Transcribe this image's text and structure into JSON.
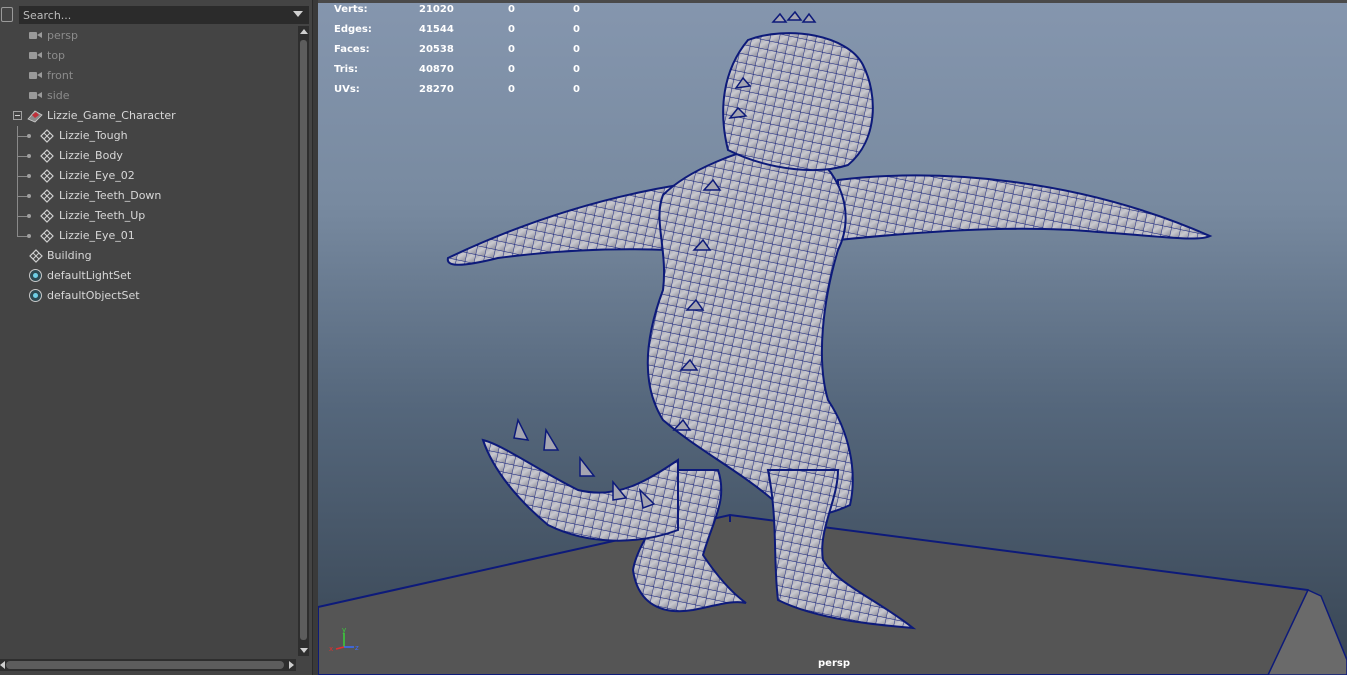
{
  "outliner": {
    "search_placeholder": "Search...",
    "items": [
      {
        "label": "persp",
        "icon": "camera-icon",
        "dim": true
      },
      {
        "label": "top",
        "icon": "camera-icon",
        "dim": true
      },
      {
        "label": "front",
        "icon": "camera-icon",
        "dim": true
      },
      {
        "label": "side",
        "icon": "camera-icon",
        "dim": true
      },
      {
        "label": "Lizzie_Game_Character",
        "icon": "group-icon",
        "expanded": true
      },
      {
        "label": "Lizzie_Tough",
        "icon": "mesh-icon"
      },
      {
        "label": "Lizzie_Body",
        "icon": "mesh-icon"
      },
      {
        "label": "Lizzie_Eye_02",
        "icon": "mesh-icon"
      },
      {
        "label": "Lizzie_Teeth_Down",
        "icon": "mesh-icon"
      },
      {
        "label": "Lizzie_Teeth_Up",
        "icon": "mesh-icon"
      },
      {
        "label": "Lizzie_Eye_01",
        "icon": "mesh-icon"
      },
      {
        "label": "Building",
        "icon": "mesh-icon"
      },
      {
        "label": "defaultLightSet",
        "icon": "set-icon"
      },
      {
        "label": "defaultObjectSet",
        "icon": "set-icon"
      }
    ]
  },
  "viewport": {
    "camera": "persp",
    "hud": [
      {
        "label": "Verts:",
        "values": [
          "21020",
          "0",
          "0"
        ]
      },
      {
        "label": "Edges:",
        "values": [
          "41544",
          "0",
          "0"
        ]
      },
      {
        "label": "Faces:",
        "values": [
          "20538",
          "0",
          "0"
        ]
      },
      {
        "label": "Tris:",
        "values": [
          "40870",
          "0",
          "0"
        ]
      },
      {
        "label": "UVs:",
        "values": [
          "28270",
          "0",
          "0"
        ]
      }
    ],
    "axes": {
      "x": "x",
      "y": "y",
      "z": "z"
    },
    "colors": {
      "wireframe": "#0d1a7a",
      "mesh": "#b8b8c0",
      "floor": "#555555",
      "bg_top": "#8596ae",
      "bg_bottom": "#384553"
    }
  }
}
